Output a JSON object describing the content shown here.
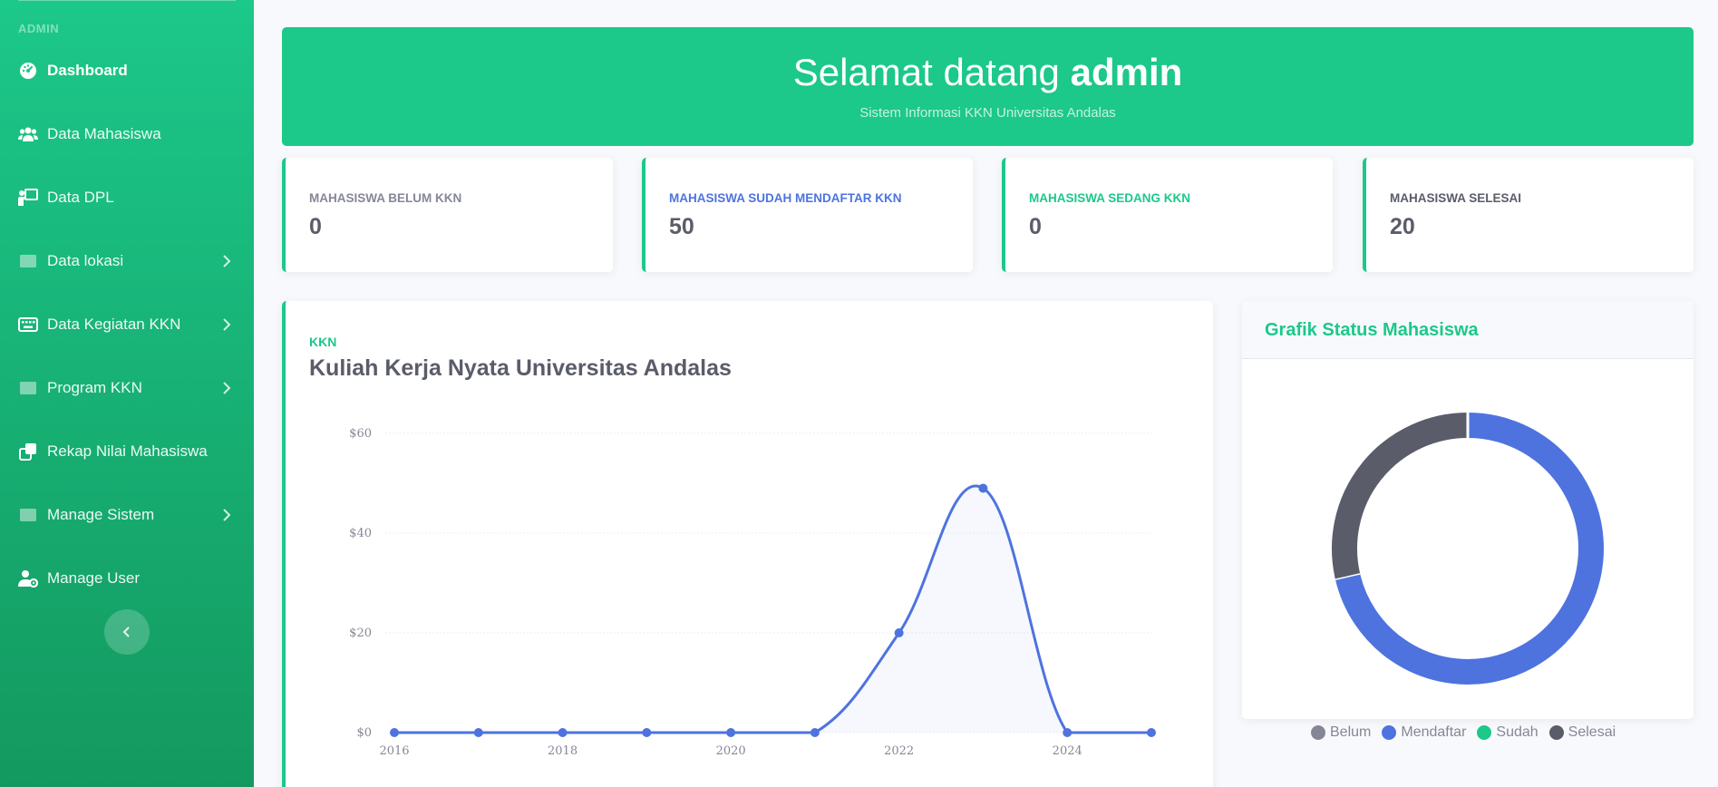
{
  "sidebar": {
    "heading": "ADMIN",
    "items": [
      {
        "label": "Dashboard",
        "icon": "dashboard-icon",
        "active": true,
        "chevron": false
      },
      {
        "label": "Data Mahasiswa",
        "icon": "users-icon",
        "active": false,
        "chevron": false
      },
      {
        "label": "Data DPL",
        "icon": "teacher-icon",
        "active": false,
        "chevron": false
      },
      {
        "label": "Data lokasi",
        "icon": "folder-icon",
        "active": false,
        "chevron": true
      },
      {
        "label": "Data Kegiatan KKN",
        "icon": "keyboard-icon",
        "active": false,
        "chevron": true
      },
      {
        "label": "Program KKN",
        "icon": "folder-icon",
        "active": false,
        "chevron": true
      },
      {
        "label": "Rekap Nilai Mahasiswa",
        "icon": "copy-icon",
        "active": false,
        "chevron": false
      },
      {
        "label": "Manage Sistem",
        "icon": "folder-icon",
        "active": false,
        "chevron": true
      },
      {
        "label": "Manage User",
        "icon": "user-gear-icon",
        "active": false,
        "chevron": false
      }
    ],
    "toggle_icon": "chevron-left-icon"
  },
  "banner": {
    "greeting": "Selamat datang",
    "username": "admin",
    "subtitle": "Sistem Informasi KKN Universitas Andalas"
  },
  "stats": [
    {
      "label": "MAHASISWA BELUM KKN",
      "value": "0",
      "color": "#858796"
    },
    {
      "label": "MAHASISWA SUDAH MENDAFTAR KKN",
      "value": "50",
      "color": "#4e73df"
    },
    {
      "label": "MAHASISWA SEDANG KKN",
      "value": "0",
      "color": "#1cc88a"
    },
    {
      "label": "MAHASISWA SELESAI",
      "value": "20",
      "color": "#5a5c69"
    }
  ],
  "chart_card": {
    "kicker": "KKN",
    "title": "Kuliah Kerja Nyata Universitas Andalas"
  },
  "donut_card": {
    "title": "Grafik Status Mahasiswa"
  },
  "chart_data": [
    {
      "type": "area",
      "x": [
        2016,
        2017,
        2018,
        2019,
        2020,
        2021,
        2022,
        2023,
        2024,
        2025
      ],
      "series": [
        {
          "values": [
            0,
            0,
            0,
            0,
            0,
            0,
            20,
            49,
            0,
            0
          ],
          "color": "#4e73df"
        }
      ],
      "x_tick_labels": [
        "2016",
        "2018",
        "2020",
        "2022",
        "2024"
      ],
      "y_tick_labels": [
        "$0",
        "$20",
        "$40",
        "$60"
      ],
      "ylim": [
        0,
        60
      ],
      "grid": true
    },
    {
      "type": "pie",
      "variant": "donut",
      "labels": [
        "Belum",
        "Mendaftar",
        "Sudah",
        "Selesai"
      ],
      "values": [
        0,
        50,
        0,
        20
      ],
      "colors": [
        "#858796",
        "#4e73df",
        "#1cc88a",
        "#5a5c69"
      ],
      "legend": "bottom"
    }
  ]
}
